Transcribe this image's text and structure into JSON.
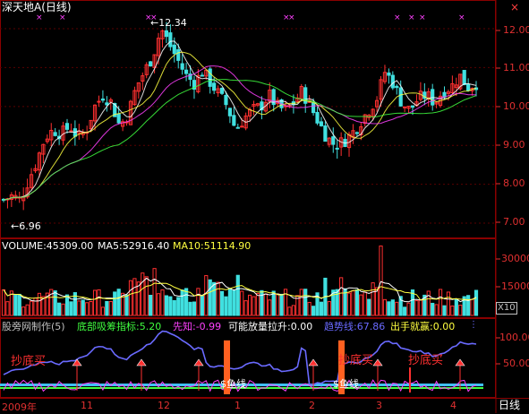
{
  "colors": {
    "up": "#ff3030",
    "down": "#40e0e0",
    "grid": "#7a0000",
    "bg": "#000000",
    "axis_text": "#e03030",
    "ma5": "#ffffff",
    "ma10": "#ffff40",
    "trend": "#6a6aff",
    "marker": "#ff40ff"
  },
  "title": {
    "stock": "深天地A",
    "period": "(日线)",
    "ctrl": "×"
  },
  "price_panel": {
    "high_label": "12.34",
    "low_label": "6.96",
    "y_ticks": [
      "12.00",
      "11.00",
      "10.00",
      "9.00",
      "8.00",
      "7.00"
    ]
  },
  "volume_panel": {
    "volume_label": "VOLUME:45309.00",
    "ma5_label": "MA5:52916.40",
    "ma10_label": "MA10:51114.90",
    "y_ticks": [
      "30000",
      "15000"
    ],
    "unit": "X10"
  },
  "indicator_panel": {
    "name": "股旁网制作(5)",
    "i1": "底部吸筹指标:5.20",
    "i2": "先知:-0.99",
    "i3": "可能放量拉升:0.00",
    "i4": "趋势线:67.86",
    "i5": "出手就赢:0.00",
    "y_ticks": [
      "100.00",
      "50.00"
    ],
    "buy_labels": [
      "抄底买",
      "抄底买",
      "抄底买"
    ],
    "cash_labels": [
      "$鱼线",
      "$鱼线"
    ]
  },
  "time_axis": {
    "labels": [
      "2009年",
      "11",
      "12",
      "1",
      "2",
      "3",
      "4"
    ],
    "period_btn": "日线"
  },
  "chart_data": {
    "type": "candlestick",
    "price_range": [
      6.7,
      12.6
    ],
    "high": 12.34,
    "low": 6.96,
    "close_path": [
      7.6,
      7.7,
      7.6,
      8.1,
      8.6,
      9.2,
      9.4,
      9.3,
      9.5,
      9.2,
      9.4,
      10.0,
      10.3,
      10.1,
      9.5,
      9.8,
      10.5,
      10.9,
      11.3,
      12.0,
      11.6,
      11.2,
      10.8,
      10.6,
      10.9,
      10.6,
      10.3,
      10.0,
      9.4,
      9.7,
      9.9,
      10.0,
      10.3,
      10.0,
      9.9,
      10.1,
      10.4,
      10.0,
      9.6,
      9.2,
      9.0,
      9.1,
      9.3,
      9.6,
      9.9,
      10.2,
      10.9,
      10.6,
      10.1,
      9.9,
      10.2,
      10.3,
      10.1,
      10.4,
      10.5,
      10.8,
      10.5,
      10.6
    ],
    "volume_range": [
      0,
      36000
    ],
    "indicator_range": [
      0,
      125
    ]
  }
}
